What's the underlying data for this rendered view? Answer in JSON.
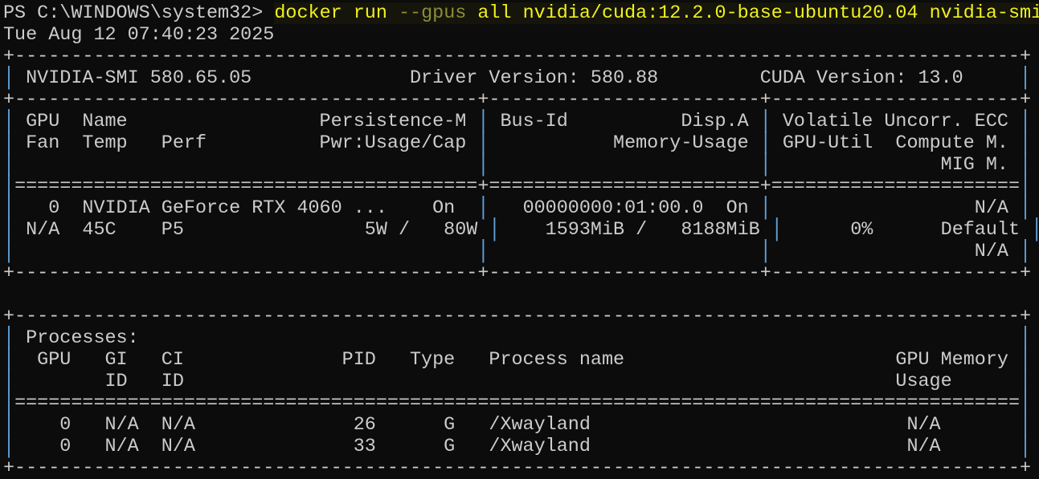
{
  "terminal": {
    "prompt": "PS C:\\WINDOWS\\system32> ",
    "command": {
      "exe": "docker run ",
      "param": "--gpus",
      "args": " all nvidia/cuda:12.2.0-base-ubuntu20.04 nvidia-smi"
    },
    "lines": [
      "Tue Aug 12 07:40:23 2025",
      "+-----------------------------------------------------------------------------------------+",
      "| NVIDIA-SMI 580.65.05              Driver Version: 580.88         CUDA Version: 13.0     |",
      "+-----------------------------------------+------------------------+----------------------+",
      "| GPU  Name                 Persistence-M | Bus-Id          Disp.A | Volatile Uncorr. ECC |",
      "| Fan  Temp   Perf          Pwr:Usage/Cap |           Memory-Usage | GPU-Util  Compute M. |",
      "|                                         |                        |               MIG M. |",
      "|=========================================+========================+======================|",
      "|   0  NVIDIA GeForce RTX 4060 ...    On  |   00000000:01:00.0  On |                  N/A |",
      "| N/A  45C    P5                5W /   80W |    1593MiB /   8188MiB |      0%      Default |",
      "|                                         |                        |                  N/A |",
      "+-----------------------------------------+------------------------+----------------------+",
      "",
      "+-----------------------------------------------------------------------------------------+",
      "| Processes:                                                                              |",
      "|  GPU   GI   CI              PID   Type   Process name                        GPU Memory |",
      "|        ID   ID                                                               Usage      |",
      "|=========================================================================================|",
      "|    0   N/A  N/A              26      G   /Xwayland                            N/A       |",
      "|    0   N/A  N/A              33      G   /Xwayland                            N/A       |",
      "+-----------------------------------------------------------------------------------------+"
    ]
  },
  "colors": {
    "background": "#0c0c0c",
    "text": "#cccccc",
    "command": "#f0f020",
    "pipe": "#5f9fd6"
  }
}
